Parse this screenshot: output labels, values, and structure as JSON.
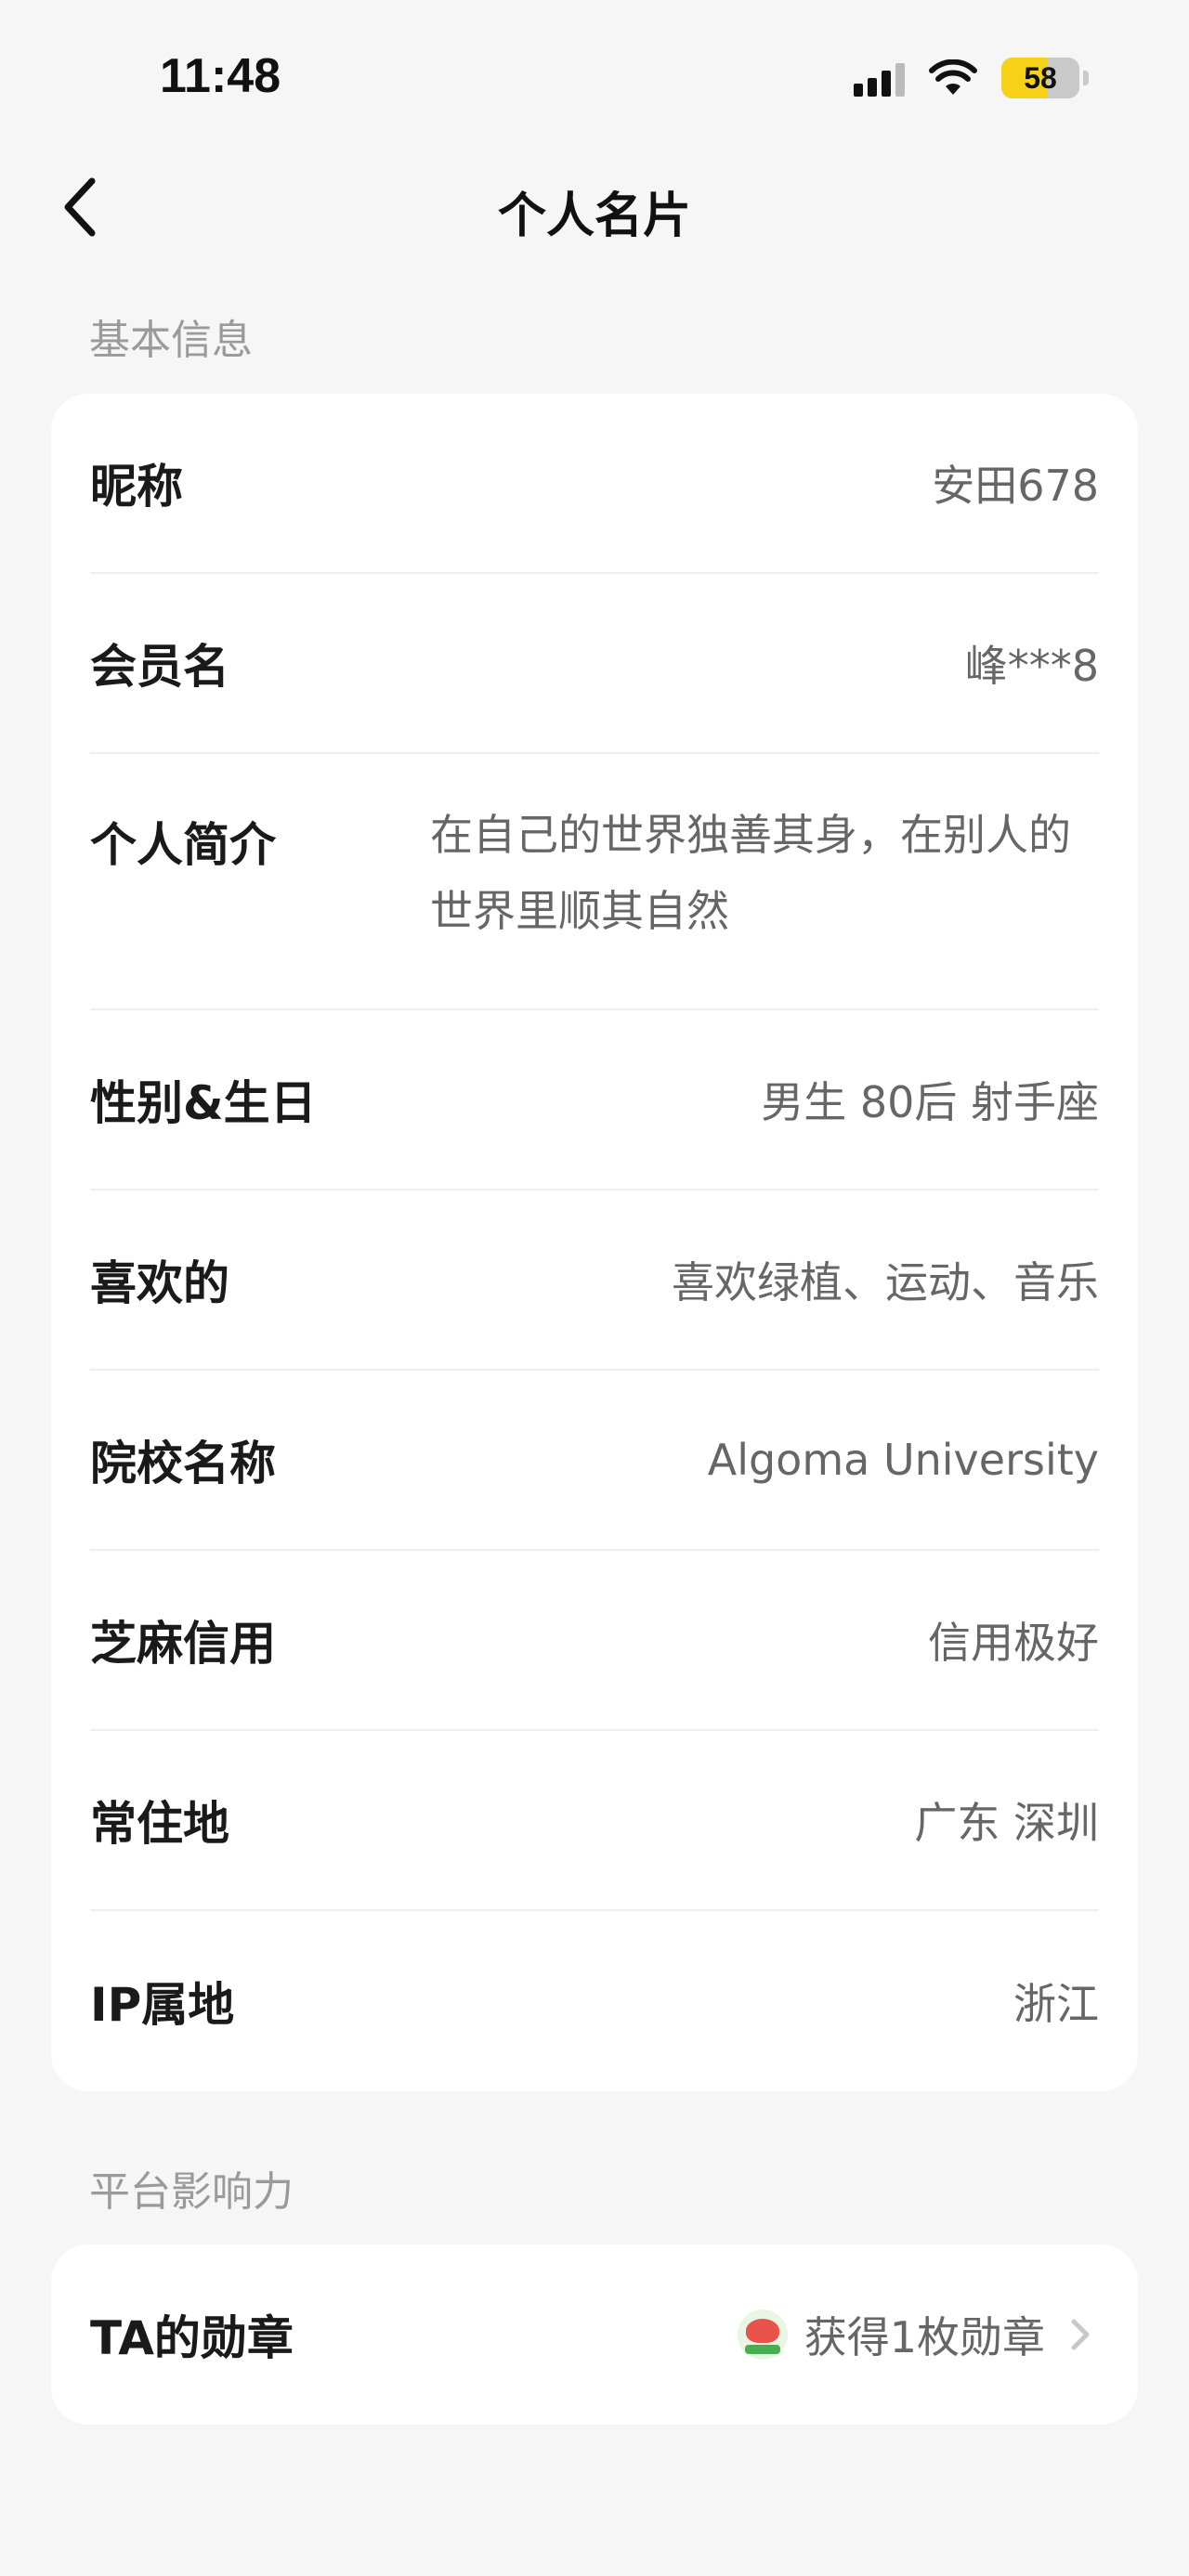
{
  "status": {
    "time": "11:48",
    "battery": "58",
    "battery_level": 0.58
  },
  "nav": {
    "title": "个人名片"
  },
  "basic": {
    "section_title": "基本信息",
    "rows": [
      {
        "label": "昵称",
        "value": "安田678"
      },
      {
        "label": "会员名",
        "value": "峰***8"
      },
      {
        "label": "个人简介",
        "value": "在自己的世界独善其身，在别人的世界里顺其自然"
      },
      {
        "label": "性别&生日",
        "value": "男生 80后 射手座"
      },
      {
        "label": "喜欢的",
        "value": "喜欢绿植、运动、音乐"
      },
      {
        "label": "院校名称",
        "value": "Algoma University"
      },
      {
        "label": "芝麻信用",
        "value": "信用极好"
      },
      {
        "label": "常住地",
        "value": "广东 深圳"
      },
      {
        "label": "IP属地",
        "value": "浙江"
      }
    ]
  },
  "influence": {
    "section_title": "平台影响力",
    "medal": {
      "label": "TA的勋章",
      "value": "获得1枚勋章"
    }
  },
  "colors": {
    "accent_battery": "#f7d117",
    "background": "#f6f6f6"
  }
}
